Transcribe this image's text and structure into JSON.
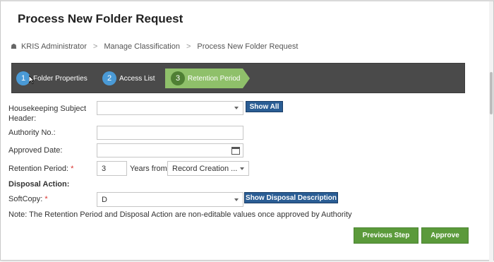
{
  "page": {
    "title": "Process New Folder Request"
  },
  "breadcrumb": {
    "items": [
      "KRIS Administrator",
      "Manage Classification",
      "Process New Folder Request"
    ],
    "separator": ">"
  },
  "wizard": {
    "steps": [
      {
        "number": "1",
        "label": "Folder Properties",
        "state": "complete"
      },
      {
        "number": "2",
        "label": "Access List",
        "state": "complete"
      },
      {
        "number": "3",
        "label": "Retention Period",
        "state": "active"
      }
    ]
  },
  "form": {
    "housekeeping_label": "Housekeeping Subject Header:",
    "housekeeping_value": "",
    "show_all_label": "Show All",
    "authority_label": "Authority No.:",
    "authority_value": "",
    "approved_date_label": "Approved Date:",
    "approved_date_value": "",
    "retention_label": "Retention Period:",
    "retention_value": "3",
    "years_from_label": "Years from",
    "years_from_value": "Record Creation ...",
    "disposal_action_label": "Disposal Action:",
    "softcopy_label": "SoftCopy:",
    "softcopy_value": "D",
    "show_disposal_label": "Show Disposal Description",
    "required_marker": "*"
  },
  "note": "Note: The Retention Period and Disposal Action are non-editable values once approved by Authority",
  "actions": {
    "previous_label": "Previous Step",
    "approve_label": "Approve"
  },
  "colors": {
    "wizard_bg": "#4a4a4a",
    "step_done": "#4a9ad6",
    "step_active": "#8fc06a",
    "primary_button": "#2a5d94",
    "action_button": "#5b9a3b",
    "required": "#d9322f"
  }
}
